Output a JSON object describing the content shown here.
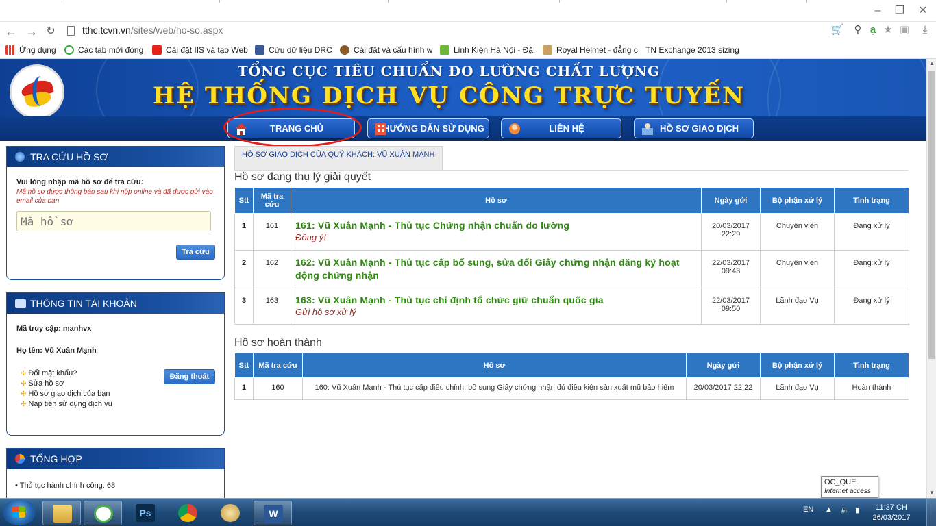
{
  "browser": {
    "url_host": "tthc.tcvn.vn",
    "url_path": "/sites/web/ho-so.aspx",
    "bookmarks": [
      {
        "label": "Ứng dụng",
        "color": "#e33b2e"
      },
      {
        "label": "Các tab mới đóng",
        "color": "#3aa640"
      },
      {
        "label": "Cài đặt IIS và tạo Web",
        "color": "#e62117"
      },
      {
        "label": "Cứu dữ liệu DRC",
        "color": "#3b5998"
      },
      {
        "label": "Cài đặt và cấu hình w",
        "color": "#8a5a2b"
      },
      {
        "label": "Linh Kiện Hà Nội - Đặ",
        "color": "#6fb53a"
      },
      {
        "label": "Royal Helmet - đẳng c",
        "color": "#c8a060"
      },
      {
        "label": "TN Exchange 2013 sizing",
        "color": "#ffffff"
      }
    ]
  },
  "site": {
    "org_name": "TỔNG CỤC TIÊU CHUẨN ĐO LƯỜNG CHẤT LƯỢNG",
    "system_name": "HỆ THỐNG DỊCH VỤ CÔNG TRỰC TUYẾN",
    "menu": [
      {
        "label": "TRANG CHỦ"
      },
      {
        "label": "HƯỚNG DẪN SỬ DỤNG"
      },
      {
        "label": "LIÊN HỆ"
      },
      {
        "label": "HỒ SƠ GIAO DỊCH"
      }
    ]
  },
  "lookup": {
    "title": "TRA CỨU HỒ SƠ",
    "prompt": "Vui lòng nhập mã hồ sơ để tra cứu:",
    "hint": "Mã hồ sơ được thông báo sau khi nộp online và đã được gửi vào email của bạn",
    "placeholder": "Mã hồ sơ",
    "button": "Tra cứu"
  },
  "account": {
    "title": "THÔNG TIN TÀI KHOẢN",
    "access_label": "Mã truy cập: manhvx",
    "name_label": "Họ tên: Vũ Xuân Mạnh",
    "logout": "Đăng thoát",
    "links": [
      "Đổi mật khẩu?",
      "Sửa hồ sơ",
      "Hồ sơ giao dịch của bạn",
      "Nạp tiền sử dụng dịch vụ"
    ]
  },
  "summary": {
    "title": "TỔNG HỢP",
    "items": [
      "Thủ tục hành chính công: 68"
    ]
  },
  "main": {
    "tab": "HỒ SƠ GIAO DỊCH CỦA QUÝ KHÁCH: VŨ XUÂN MẠNH",
    "processing_title": "Hồ sơ đang thụ lý giải quyết",
    "completed_title": "Hồ sơ hoàn thành",
    "headers": {
      "stt": "Stt",
      "code": "Mã tra cứu",
      "file": "Hồ sơ",
      "date": "Ngày gửi",
      "dept": "Bộ phận xử lý",
      "status": "Tình trạng"
    },
    "processing": [
      {
        "stt": "1",
        "code": "161",
        "title": "161: Vũ Xuân Mạnh - Thủ tục Chứng nhận chuẩn đo lường",
        "note": "Đồng ý!",
        "date": "20/03/2017",
        "time": "22:29",
        "dept": "Chuyên viên",
        "status": "Đang xử lý"
      },
      {
        "stt": "2",
        "code": "162",
        "title": "162: Vũ Xuân Mạnh - Thủ tục cấp bổ sung, sửa đổi Giấy chứng nhận đăng ký hoạt động chứng nhận",
        "note": "",
        "date": "22/03/2017",
        "time": "09:43",
        "dept": "Chuyên viên",
        "status": "Đang xử lý"
      },
      {
        "stt": "3",
        "code": "163",
        "title": "163: Vũ Xuân Mạnh - Thủ tục chỉ định tổ chức giữ chuẩn quốc gia",
        "note": "Gửi hồ sơ xử lý",
        "date": "22/03/2017",
        "time": "09:50",
        "dept": "Lãnh đạo Vụ",
        "status": "Đang xử lý"
      }
    ],
    "completed": [
      {
        "stt": "1",
        "code": "160",
        "title": "160: Vũ Xuân Mạnh - Thủ tục cấp điều chỉnh, bổ sung Giấy chứng nhận đủ điều kiện sản xuất mũ bảo hiểm",
        "date": "20/03/2017 22:22",
        "dept": "Lãnh đạo Vụ",
        "status": "Hoàn thành"
      }
    ]
  },
  "tooltip": {
    "line1": "OC_QUE",
    "line2": "Internet access"
  },
  "taskbar": {
    "lang": "EN",
    "time": "11:37 CH",
    "date": "26/03/2017",
    "ps_label": "Ps",
    "word_label": "W"
  }
}
